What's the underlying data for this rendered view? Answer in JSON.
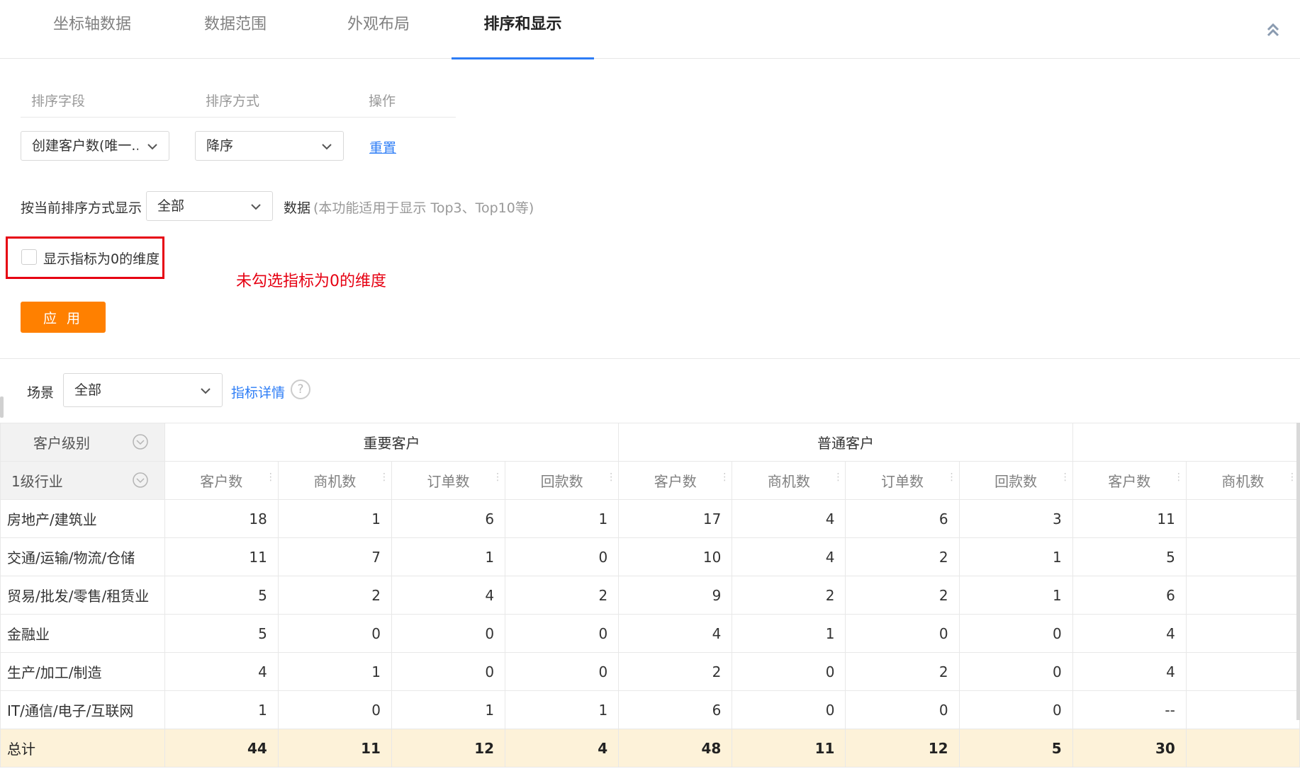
{
  "tabs": [
    {
      "label": "坐标轴数据"
    },
    {
      "label": "数据范围"
    },
    {
      "label": "外观布局"
    },
    {
      "label": "排序和显示"
    }
  ],
  "active_tab": "排序和显示",
  "sort": {
    "headers": {
      "field": "排序字段",
      "order": "排序方式",
      "action": "操作"
    },
    "field_value": "创建客户数(唯一...",
    "order_value": "降序",
    "reset_label": "重置"
  },
  "display": {
    "label": "按当前排序方式显示",
    "value": "全部",
    "suffix": "数据",
    "hint": "(本功能适用于显示 Top3、Top10等)"
  },
  "zero_dim": {
    "label": "显示指标为0的维度",
    "checked": false
  },
  "annotation": "未勾选指标为0的维度",
  "apply_label": "应 用",
  "scene": {
    "label": "场景",
    "value": "全部",
    "metric_link": "指标详情",
    "help": "?"
  },
  "table": {
    "dim_header_1": "客户级别",
    "dim_header_2": "1级行业",
    "groups": [
      "重要客户",
      "普通客户",
      ""
    ],
    "metrics": [
      "客户数",
      "商机数",
      "订单数",
      "回款数",
      "客户数",
      "商机数",
      "订单数",
      "回款数",
      "客户数",
      "商机数"
    ],
    "rows": [
      {
        "name": "房地产/建筑业",
        "values": [
          "18",
          "1",
          "6",
          "1",
          "17",
          "4",
          "6",
          "3",
          "11",
          ""
        ]
      },
      {
        "name": "交通/运输/物流/仓储",
        "values": [
          "11",
          "7",
          "1",
          "0",
          "10",
          "4",
          "2",
          "1",
          "5",
          ""
        ]
      },
      {
        "name": "贸易/批发/零售/租赁业",
        "values": [
          "5",
          "2",
          "4",
          "2",
          "9",
          "2",
          "2",
          "1",
          "6",
          ""
        ]
      },
      {
        "name": "金融业",
        "values": [
          "5",
          "0",
          "0",
          "0",
          "4",
          "1",
          "0",
          "0",
          "4",
          ""
        ]
      },
      {
        "name": "生产/加工/制造",
        "values": [
          "4",
          "1",
          "0",
          "0",
          "2",
          "0",
          "2",
          "0",
          "4",
          ""
        ]
      },
      {
        "name": "IT/通信/电子/互联网",
        "values": [
          "1",
          "0",
          "1",
          "1",
          "6",
          "0",
          "0",
          "0",
          "--",
          ""
        ]
      }
    ],
    "total": {
      "name": "总计",
      "values": [
        "44",
        "11",
        "12",
        "4",
        "48",
        "11",
        "12",
        "5",
        "30",
        ""
      ]
    }
  },
  "colors": {
    "accent_blue": "#2d7df6",
    "apply_orange": "#ff8000",
    "annotation_red": "#e60012",
    "total_row_bg": "#fdf2d9"
  }
}
